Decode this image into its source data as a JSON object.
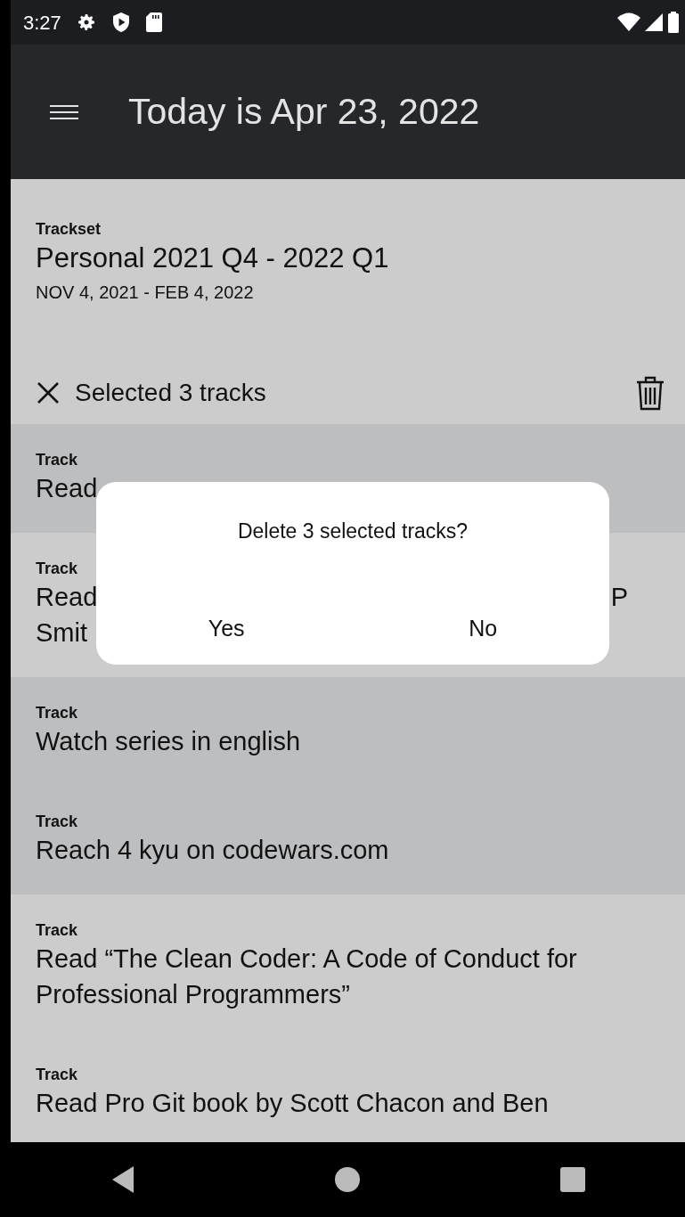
{
  "status_bar": {
    "time": "3:27"
  },
  "app_bar": {
    "title": "Today is Apr 23, 2022"
  },
  "trackset": {
    "label": "Trackset",
    "name": "Personal 2021 Q4 - 2022 Q1",
    "dates": "NOV 4, 2021 - FEB 4, 2022"
  },
  "selection_bar": {
    "text": "Selected 3 tracks"
  },
  "tracks": [
    {
      "label": "Track",
      "selected": true,
      "lines": [
        [
          "Read"
        ]
      ]
    },
    {
      "label": "Track",
      "selected": false,
      "lines": [
        [
          "Read",
          "P"
        ],
        [
          "Smit"
        ]
      ]
    },
    {
      "label": "Track",
      "selected": true,
      "lines": [
        [
          "Watch series in english"
        ]
      ]
    },
    {
      "label": "Track",
      "selected": true,
      "lines": [
        [
          "Reach 4 kyu on codewars.com"
        ]
      ]
    },
    {
      "label": "Track",
      "selected": false,
      "lines": [
        [
          "Read “The Clean Coder: A Code of Conduct for Professional Programmers”"
        ]
      ]
    },
    {
      "label": "Track",
      "selected": false,
      "lines": [
        [
          "Read Pro Git book by Scott Chacon and Ben"
        ]
      ]
    }
  ],
  "dialog": {
    "message": "Delete 3 selected tracks?",
    "buttons": [
      "Yes",
      "No"
    ]
  }
}
